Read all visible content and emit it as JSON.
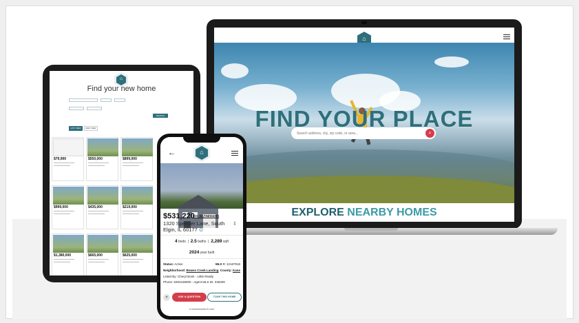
{
  "laptop": {
    "hero_title": "FIND YOUR PLACE",
    "search_placeholder": "Search address, city, zip code, or area...",
    "search_icon": "search-icon",
    "explore_part1": "EXPLORE",
    "explore_part2": "NEARBY HOMES"
  },
  "tablet": {
    "title": "Find your new home",
    "search_button": "SEARCH",
    "tabs": [
      "LIST VIEW",
      "MAP VIEW"
    ],
    "listings": [
      {
        "price": "$79,900"
      },
      {
        "price": "$550,000"
      },
      {
        "price": "$899,000"
      },
      {
        "price": "$999,000"
      },
      {
        "price": "$435,000"
      },
      {
        "price": "$219,000"
      },
      {
        "price": "$1,380,000"
      },
      {
        "price": "$665,000"
      },
      {
        "price": "$625,000"
      }
    ]
  },
  "phone": {
    "price": "$531,220",
    "estimate": "Est. $2,734/month",
    "address": "1320 Spencer Lane, South Elgin, IL 60177",
    "beds_value": "4",
    "beds_label": "beds",
    "baths_value": "2.5",
    "baths_label": "baths",
    "sqft_value": "2,289",
    "sqft_label": "sqft",
    "year_value": "2024",
    "year_label": "year built",
    "status_label": "Status:",
    "status_value": "Active",
    "mls_label": "MLS #:",
    "mls_value": "12187918",
    "neighborhood_label": "Neighborhood:",
    "neighborhood_value": "Bowes Creek Landing",
    "county_label": "County:",
    "county_value": "Kane",
    "listed_by": "Listed By: Cheryl Bonk - Little Realty",
    "phone_line": "Phone: 6304169000 - Agent MLS ID: 236300",
    "ask_button": "ASK A QUESTION",
    "tour_button": "TOUR THIS HOME",
    "url": "e.schomesearch.com"
  },
  "colors": {
    "brand_teal": "#2f6f7b",
    "accent_red": "#d43d4a"
  }
}
